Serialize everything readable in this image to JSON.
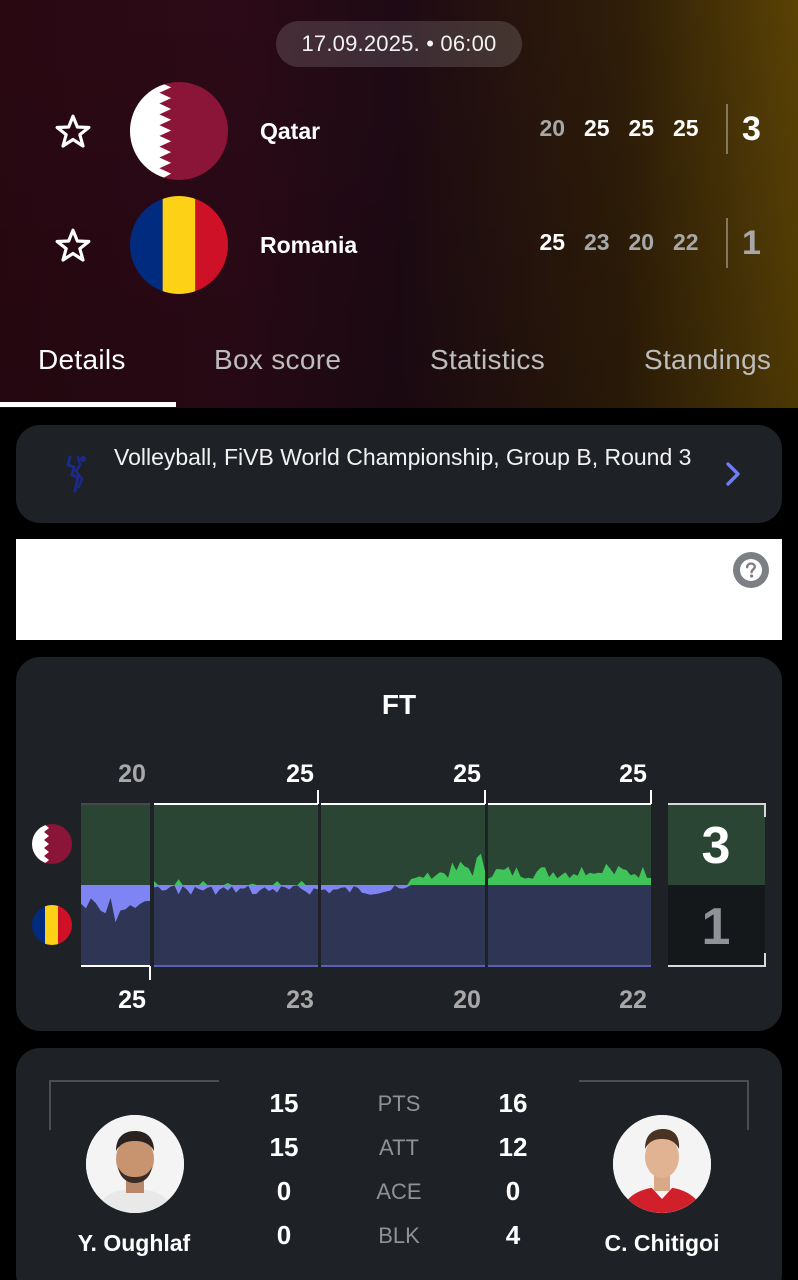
{
  "match": {
    "datetime": "17.09.2025. • 06:00",
    "home": {
      "name": "Qatar",
      "set_scores": [
        "20",
        "25",
        "25",
        "25"
      ],
      "set_winner": [
        false,
        true,
        true,
        true
      ],
      "final": "3",
      "flag_colors": [
        "#ffffff",
        "#8a1538"
      ]
    },
    "away": {
      "name": "Romania",
      "set_scores": [
        "25",
        "23",
        "20",
        "22"
      ],
      "set_winner": [
        true,
        false,
        false,
        false
      ],
      "final": "1",
      "flag_colors": [
        "#002b7f",
        "#fcd116",
        "#ce1126"
      ]
    }
  },
  "tabs": [
    {
      "label": "Details",
      "active": true
    },
    {
      "label": "Box score",
      "active": false
    },
    {
      "label": "Statistics",
      "active": false
    },
    {
      "label": "Standings",
      "active": false
    }
  ],
  "competition": {
    "text": "Volleyball, FiVB World Championship, Group B, Round 3",
    "icon": "volleyball-league-icon"
  },
  "help": {
    "icon": "question-icon"
  },
  "momentum": {
    "status": "FT",
    "home_set_labels": [
      "20",
      "25",
      "25",
      "25"
    ],
    "away_set_labels": [
      "25",
      "23",
      "20",
      "22"
    ],
    "home_final": "3",
    "away_final": "1",
    "colors": {
      "home_bg": "#2b4534",
      "home_fill": "#3fc45a",
      "away_bg": "#2f3554",
      "away_fill": "#7f84f5"
    }
  },
  "players": {
    "home": {
      "name": "Y. Oughlaf"
    },
    "away": {
      "name": "C. Chitigoi"
    },
    "stats": [
      {
        "label": "PTS",
        "home": "15",
        "away": "16"
      },
      {
        "label": "ATT",
        "home": "15",
        "away": "12"
      },
      {
        "label": "ACE",
        "home": "0",
        "away": "0"
      },
      {
        "label": "BLK",
        "home": "0",
        "away": "4"
      }
    ]
  },
  "colors": {
    "card_bg": "#1e2126",
    "accent_blue": "#6e7cf5"
  }
}
